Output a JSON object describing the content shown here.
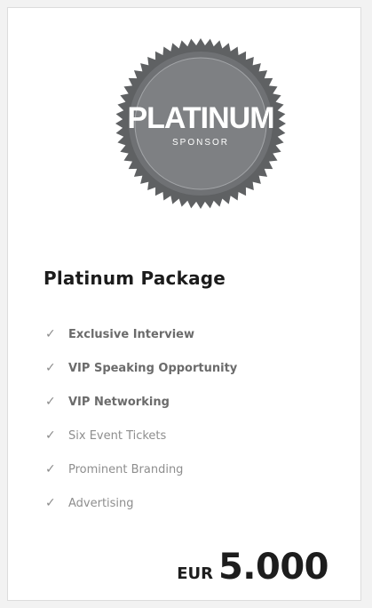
{
  "badge": {
    "line1": "PLATINUM",
    "line2": "SPONSOR",
    "colors": {
      "outer": "#5f6163",
      "inner": "#7e8083",
      "text": "#ffffff"
    }
  },
  "package": {
    "title": "Platinum Package",
    "features": [
      {
        "label": "Exclusive Interview",
        "style": "strong"
      },
      {
        "label": "VIP Speaking Opportunity",
        "style": "strong"
      },
      {
        "label": "VIP Networking",
        "style": "strong"
      },
      {
        "label": "Six Event Tickets",
        "style": "light"
      },
      {
        "label": "Prominent Branding",
        "style": "light"
      },
      {
        "label": "Advertising",
        "style": "light"
      }
    ],
    "check_icon": "check-icon",
    "price": {
      "currency": "EUR",
      "amount": "5.000"
    }
  }
}
